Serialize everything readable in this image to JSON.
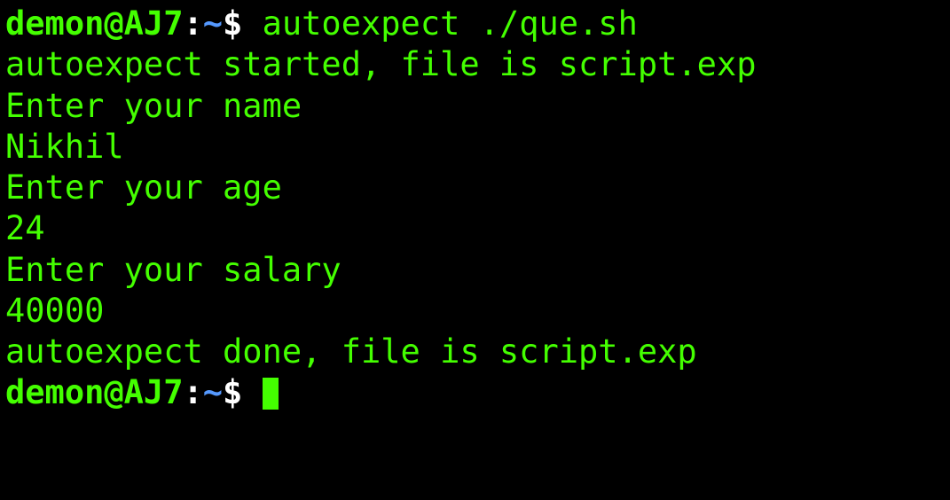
{
  "prompt": {
    "user_host": "demon@AJ7",
    "colon": ":",
    "path": "~",
    "dollar": "$ "
  },
  "lines": {
    "command1": "autoexpect ./que.sh",
    "output1": "autoexpect started, file is script.exp",
    "output2": "Enter your name",
    "output3": "Nikhil",
    "output4": "Enter your age",
    "output5": "24",
    "output6": "Enter your salary",
    "output7": "40000",
    "output8": "autoexpect done, file is script.exp"
  }
}
